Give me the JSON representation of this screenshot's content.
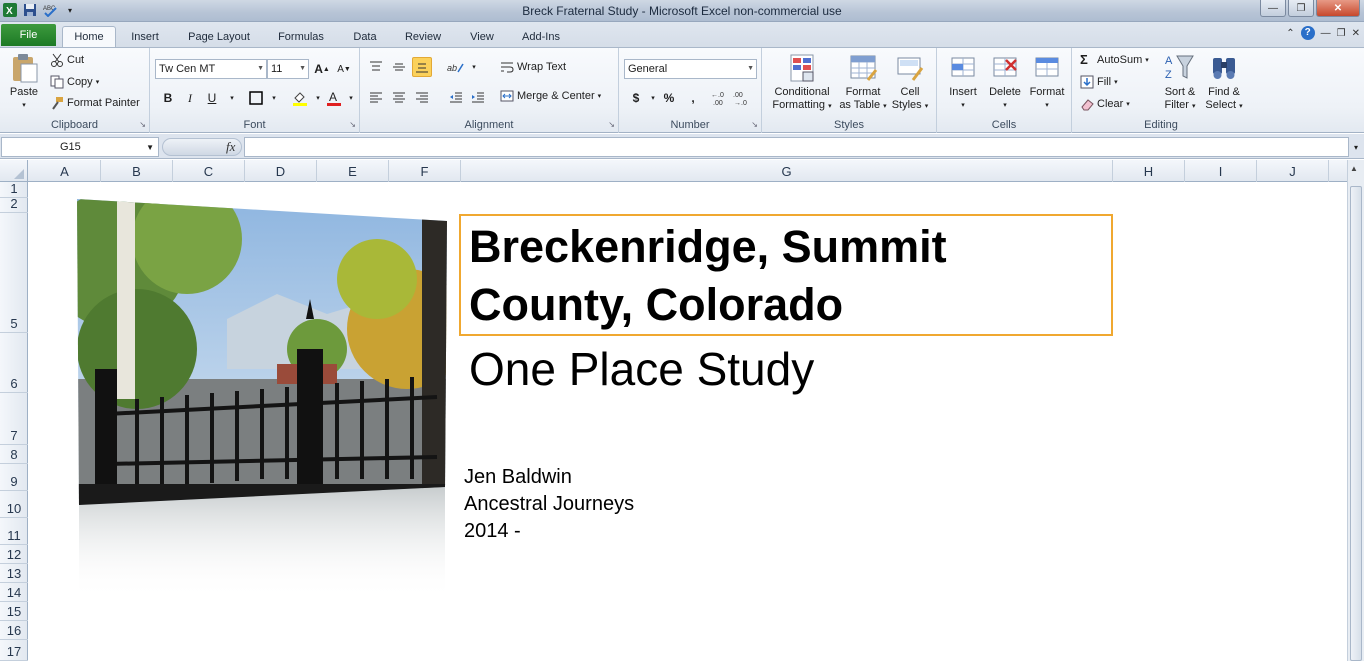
{
  "window": {
    "title": "Breck Fraternal Study  -  Microsoft Excel non-commercial use",
    "controls": [
      "minimize",
      "restore",
      "close"
    ]
  },
  "tabs": {
    "file": "File",
    "items": [
      "Home",
      "Insert",
      "Page Layout",
      "Formulas",
      "Data",
      "Review",
      "View",
      "Add-Ins"
    ],
    "active": "Home"
  },
  "ribbon": {
    "clipboard": {
      "label": "Clipboard",
      "paste": "Paste",
      "cut": "Cut",
      "copy": "Copy",
      "format_painter": "Format Painter"
    },
    "font": {
      "label": "Font",
      "font_name": "Tw Cen MT",
      "font_size": "11",
      "bold": "B",
      "italic": "I",
      "underline": "U"
    },
    "alignment": {
      "label": "Alignment",
      "wrap_text": "Wrap Text",
      "merge_center": "Merge & Center"
    },
    "number": {
      "label": "Number",
      "format": "General",
      "currency": "$",
      "percent": "%",
      "comma": ","
    },
    "styles": {
      "label": "Styles",
      "conditional": "Conditional",
      "formatting": "Formatting",
      "format": "Format",
      "as_table": "as Table",
      "cell": "Cell",
      "styles": "Styles"
    },
    "cells": {
      "label": "Cells",
      "insert": "Insert",
      "delete": "Delete",
      "format": "Format"
    },
    "editing": {
      "label": "Editing",
      "autosum": "AutoSum",
      "fill": "Fill",
      "clear": "Clear",
      "sort": "Sort &",
      "filter": "Filter",
      "find": "Find &",
      "select": "Select"
    }
  },
  "formula_bar": {
    "name_box": "G15",
    "fx": "fx",
    "content": ""
  },
  "columns": [
    "A",
    "B",
    "C",
    "D",
    "E",
    "F",
    "G",
    "H",
    "I",
    "J"
  ],
  "rows": [
    "1",
    "2",
    "5",
    "6",
    "7",
    "8",
    "9",
    "10",
    "11",
    "12",
    "13",
    "14",
    "15",
    "16",
    "17"
  ],
  "sheet": {
    "title_line1": "Breckenridge, Summit",
    "title_line2": "County, Colorado",
    "subtitle": "One Place Study",
    "author": "Jen Baldwin",
    "org": "Ancestral Journeys",
    "year": "2014 -"
  },
  "colors": {
    "file_tab": "#2a8a2f",
    "selection_border": "#f0a830",
    "ribbon_bg": "#eef2f7"
  }
}
